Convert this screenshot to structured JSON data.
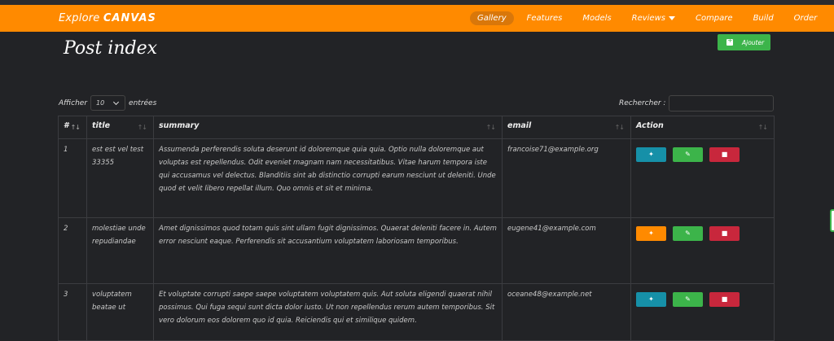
{
  "navbar": {
    "brand_prefix": "Explore",
    "brand_name": "CANVAS",
    "items": [
      {
        "label": "Gallery",
        "active": true
      },
      {
        "label": "Features"
      },
      {
        "label": "Models"
      },
      {
        "label": "Reviews"
      },
      {
        "label": "Compare"
      },
      {
        "label": "Build"
      },
      {
        "label": "Order"
      }
    ]
  },
  "page": {
    "title": "Post index",
    "add_label": "Ajouter"
  },
  "length": {
    "prefix": "Afficher",
    "value": "10",
    "suffix": "entrées"
  },
  "search": {
    "label": "Rechercher :",
    "value": ""
  },
  "table": {
    "headers": [
      "#",
      "title",
      "summary",
      "email",
      "Action"
    ],
    "rows": [
      {
        "id": "1",
        "title": "est est vel test 33355",
        "summary": "Assumenda perferendis soluta deserunt id doloremque quia quia. Optio nulla doloremque aut voluptas est repellendus. Odit eveniet magnam nam necessitatibus. Vitae harum tempora iste qui accusamus vel delectus. Blanditiis sint ab distinctio corrupti earum nesciunt ut deleniti. Unde quod et velit libero repellat illum. Quo omnis et sit et minima.",
        "email": "francoise71@example.org",
        "pin_color": "#1690a8"
      },
      {
        "id": "2",
        "title": "molestiae unde repudiandae",
        "summary": "Amet dignissimos quod totam quis sint ullam fugit dignissimos. Quaerat deleniti facere in. Autem error nesciunt eaque. Perferendis sit accusantium voluptatem laboriosam temporibus.",
        "email": "eugene41@example.com",
        "pin_color": "#ff8a00"
      },
      {
        "id": "3",
        "title": "voluptatem beatae ut",
        "summary": "Et voluptate corrupti saepe saepe voluptatem voluptatem quis. Aut soluta eligendi quaerat nihil possimus. Qui fuga sequi sunt dicta dolor iusto. Ut non repellendus rerum autem temporibus. Sit vero dolorum eos dolorem quo id quia. Reiciendis qui et similique quidem.",
        "email": "oceane48@example.net",
        "pin_color": "#1690a8"
      }
    ]
  },
  "colors": {
    "accent": "#ff8a00",
    "success": "#3cb44a",
    "danger": "#c8273c",
    "info": "#1690a8",
    "background": "#222326"
  }
}
